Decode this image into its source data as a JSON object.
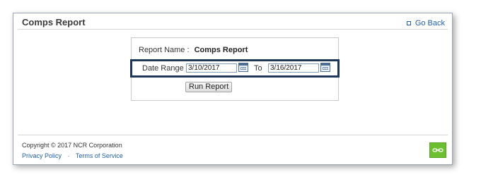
{
  "header": {
    "title": "Comps Report",
    "go_back": "Go Back"
  },
  "form": {
    "report_name_label": "Report Name :",
    "report_name_value": "Comps Report",
    "date_range_label": "Date Range :",
    "from_value": "3/10/2017",
    "to_label": "To",
    "to_value": "3/16/2017",
    "run_button": "Run Report"
  },
  "footer": {
    "copyright": "Copyright © 2017 NCR Corporation",
    "privacy_policy": "Privacy Policy",
    "separator": "·",
    "terms": "Terms of Service"
  },
  "icons": {
    "go_back": "square-bullet-icon",
    "calendar": "calendar-icon",
    "badge": "ncr-badge-icon"
  },
  "colors": {
    "highlight_border": "#1e3657",
    "link": "#1f5fa8",
    "badge": "#6cbf2e"
  }
}
